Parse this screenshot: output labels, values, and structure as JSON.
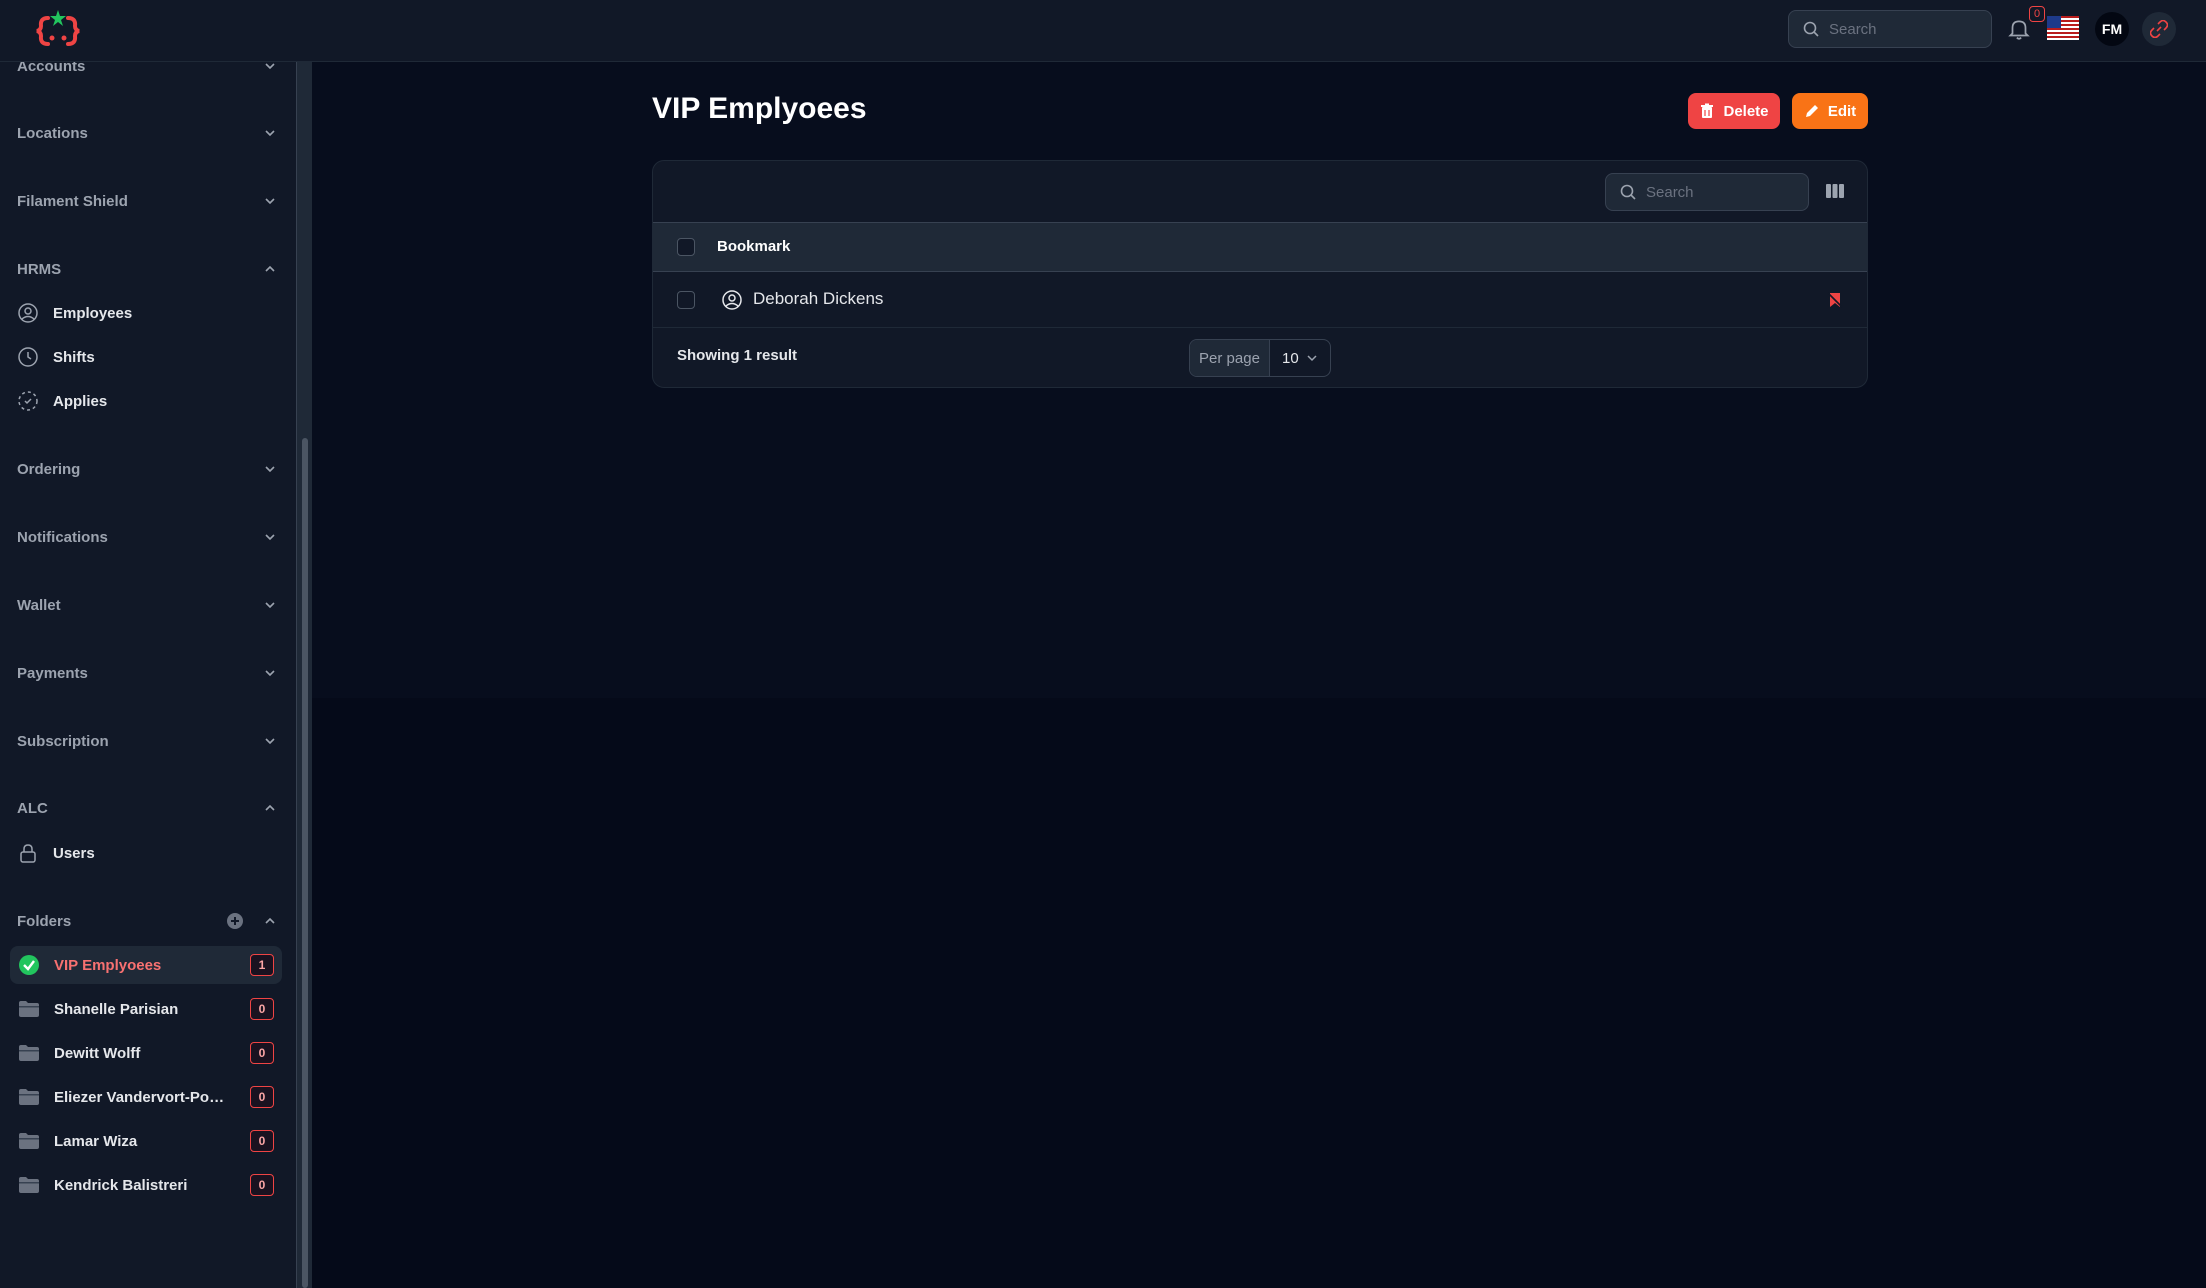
{
  "header": {
    "search_placeholder": "Search",
    "notification_count": "0",
    "avatar_initials": "FM"
  },
  "sidebar": {
    "groups": {
      "accounts": "Accounts",
      "locations": "Locations",
      "filament_shield": "Filament Shield",
      "hrms": "HRMS",
      "ordering": "Ordering",
      "notifications": "Notifications",
      "wallet": "Wallet",
      "payments": "Payments",
      "subscription": "Subscription",
      "alc": "ALC",
      "folders": "Folders"
    },
    "hrms_items": [
      "Employees",
      "Shifts",
      "Applies"
    ],
    "alc_items": [
      "Users"
    ],
    "folders": [
      {
        "name": "VIP Emplyoees",
        "count": "1",
        "active": true
      },
      {
        "name": "Shanelle Parisian",
        "count": "0"
      },
      {
        "name": "Dewitt Wolff",
        "count": "0"
      },
      {
        "name": "Eliezer Vandervort-Powlo...",
        "count": "0"
      },
      {
        "name": "Lamar Wiza",
        "count": "0"
      },
      {
        "name": "Kendrick Balistreri",
        "count": "0"
      }
    ]
  },
  "main": {
    "title": "VIP Emplyoees",
    "delete_label": "Delete",
    "edit_label": "Edit",
    "table": {
      "search_placeholder": "Search",
      "column_header": "Bookmark",
      "rows": [
        {
          "name": "Deborah Dickens"
        }
      ],
      "showing_text": "Showing 1 result",
      "per_page_label": "Per page",
      "per_page_value": "10"
    }
  },
  "colors": {
    "accent_red": "#ef4444",
    "accent_orange": "#f97316",
    "success_green": "#22c55e"
  }
}
